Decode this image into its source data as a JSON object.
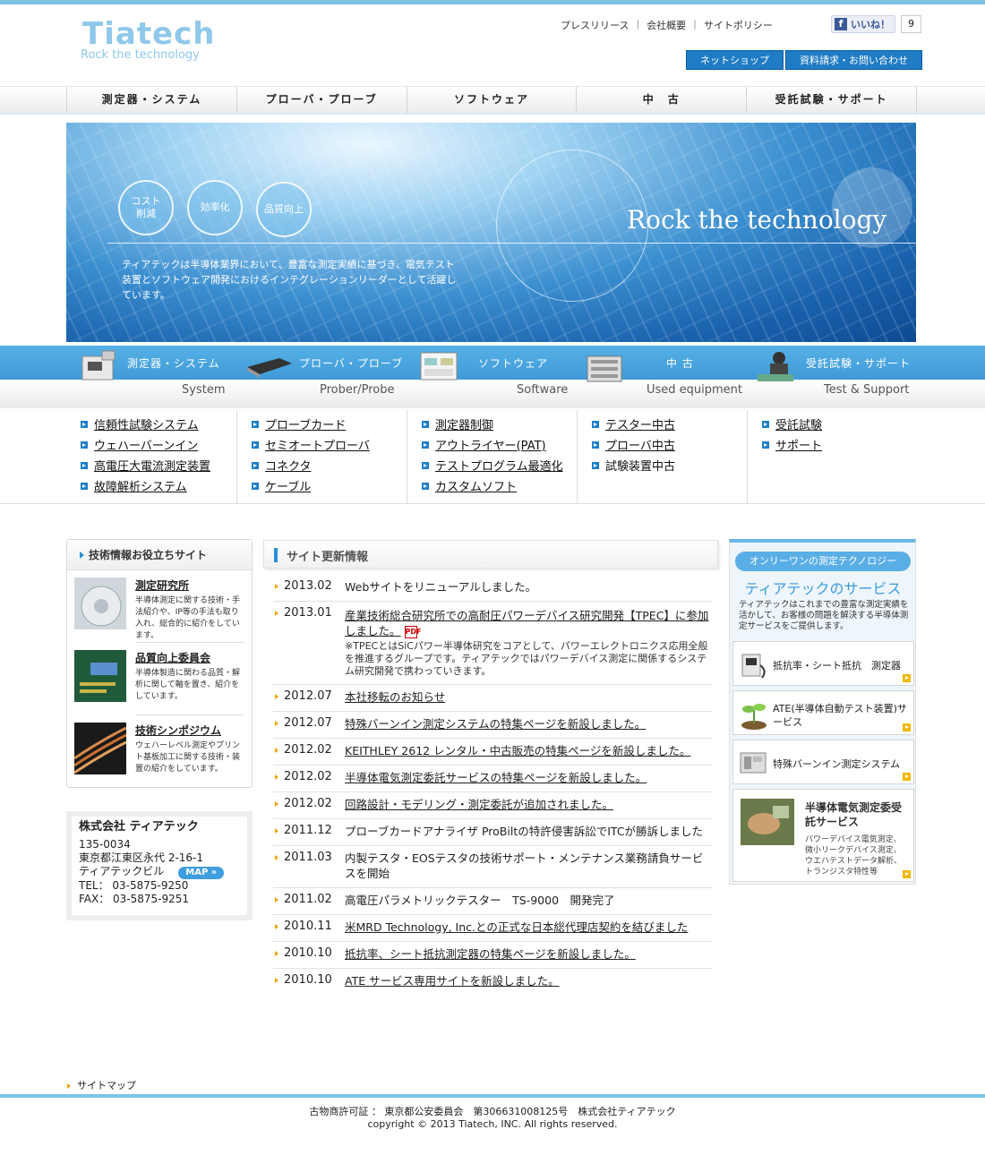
{
  "header": {
    "logo_main": "Tiatech",
    "logo_sub": "Rock the technology",
    "top_links": [
      "プレスリリース",
      "会社概要",
      "サイトポリシー"
    ],
    "facebook_like": "いいね！",
    "facebook_count": "9",
    "buttons": [
      "ネットショップ",
      "資料請求・お問い合わせ"
    ]
  },
  "nav": [
    "測定器・システム",
    "プローバ・プローブ",
    "ソフトウェア",
    "中　古",
    "受託試験・サポート"
  ],
  "hero": {
    "circles": [
      "コスト\n削減",
      "効率化",
      "品質向上"
    ],
    "title": "Rock the technology",
    "text": "ティアテックは半導体業界において、豊富な測定実績に基づき、電気テスト装置とソフトウェア開発におけるインテグレーションリーダーとして活躍しています。"
  },
  "categories": [
    {
      "title": "測定器・システム",
      "en": "System"
    },
    {
      "title": "プローバ・プローブ",
      "en": "Prober/Probe"
    },
    {
      "title": "ソフトウェア",
      "en": "Software"
    },
    {
      "title": "中 古",
      "en": "Used equipment"
    },
    {
      "title": "受託試験・サポート",
      "en": "Test & Support"
    }
  ],
  "link_columns": [
    [
      "信頼性試験システム",
      "ウェハーバーンイン",
      "高電圧大電流測定装置",
      "故障解析システム"
    ],
    [
      "プローブカード",
      "セミオートプローバ",
      "コネクタ",
      "ケーブル"
    ],
    [
      "測定器制御",
      "アウトライヤー(PAT)",
      "テストプログラム最適化",
      "カスタムソフト"
    ],
    [
      "テスター中古",
      "プローバ中古",
      "試験装置中古"
    ],
    [
      "受託試験",
      "サポート"
    ]
  ],
  "left": {
    "box_title": "技術情報お役立ちサイト",
    "items": [
      {
        "title": "測定研究所",
        "desc": "半導体測定に関する技術・手法紹介や、IP等の手法も取り入れ、総合的に紹介をしています。"
      },
      {
        "title": "品質向上委員会",
        "desc": "半導体製造に関わる品質・解析に関して軸を置き、紹介をしています。"
      },
      {
        "title": "技術シンポジウム",
        "desc": "ウェハーレベル測定やプリント基板加工に関する技術・装置の紹介をしています。"
      }
    ],
    "company": {
      "name": "株式会社 ティアテック",
      "zip": "135-0034",
      "addr": "東京都江東区永代 2-16-1",
      "bldg": "ティアテックビル",
      "map": "MAP",
      "tel": "TEL： 03-5875-9250",
      "fax": "FAX： 03-5875-9251"
    }
  },
  "news": {
    "title": "サイト更新情報",
    "items": [
      {
        "date": "2013.02",
        "text": "Webサイトをリニューアルしました。",
        "link": false
      },
      {
        "date": "2013.01",
        "text": "産業技術総合研究所での高耐圧パワーデバイス研究開発【TPEC】に参加しました。",
        "link": true,
        "note": "※TPECとはSiCパワー半導体研究をコアとして、パワーエレクトロニクス応用全般を推進するグループです。ティアテックではパワーデバイス測定に関係するシステム研究開発で携わっていきます。"
      },
      {
        "date": "2012.07",
        "text": "本社移転のお知らせ",
        "link": true
      },
      {
        "date": "2012.07",
        "text": "特殊バーンイン測定システムの特集ページを新設しました。",
        "link": true
      },
      {
        "date": "2012.02",
        "text": "KEITHLEY 2612 レンタル・中古販売の特集ページを新設しました。",
        "link": true
      },
      {
        "date": "2012.02",
        "text": "半導体電気測定委託サービスの特集ページを新設しました。",
        "link": true
      },
      {
        "date": "2012.02",
        "text": "回路設計・モデリング・測定委託が追加されました。",
        "link": true
      },
      {
        "date": "2011.12",
        "text": "プローブカードアナライザ ProBiltの特許侵害訴訟でITCが勝訴しました",
        "link": false
      },
      {
        "date": "2011.03",
        "text": "内製テスタ・EOSテスタの技術サポート・メンテナンス業務請負サービスを開始",
        "link": false
      },
      {
        "date": "2011.02",
        "text": "高電圧パラメトリックテスター　TS-9000　開発完了",
        "link": false
      },
      {
        "date": "2010.11",
        "text": "米MRD Technology, Inc.との正式な日本総代理店契約を結びました",
        "link": true
      },
      {
        "date": "2010.10",
        "text": "抵抗率、シート抵抗測定器の特集ページを新設しました。",
        "link": true
      },
      {
        "date": "2010.10",
        "text": "ATE サービス専用サイトを新設しました。",
        "link": true
      }
    ]
  },
  "right": {
    "pill": "オンリーワンの測定テクノロジー",
    "title": "ティアテックのサービス",
    "desc": "ティアテックはこれまでの豊富な測定実績を活かして、お客様の問題を解決する半導体測定サービスをご提供します。",
    "cards": [
      {
        "title": "抵抗率・シート抵抗　測定器"
      },
      {
        "title": "ATE(半導体自動テスト装置)サービス"
      },
      {
        "title": "特殊バーンイン測定システム"
      },
      {
        "title": "半導体電気測定委受託サービス",
        "desc": "パワーデバイス電気測定、微小リークデバイス測定、ウエハテストデータ解析、トランジスタ特性等"
      }
    ]
  },
  "footer": {
    "sitemap": "サイトマップ",
    "license": "古物商許可証 ： 東京都公安委員会　第306631008125号　株式会社ティアテック",
    "copyright": "copyright © 2013 Tiatech, INC. All rights reserved."
  }
}
